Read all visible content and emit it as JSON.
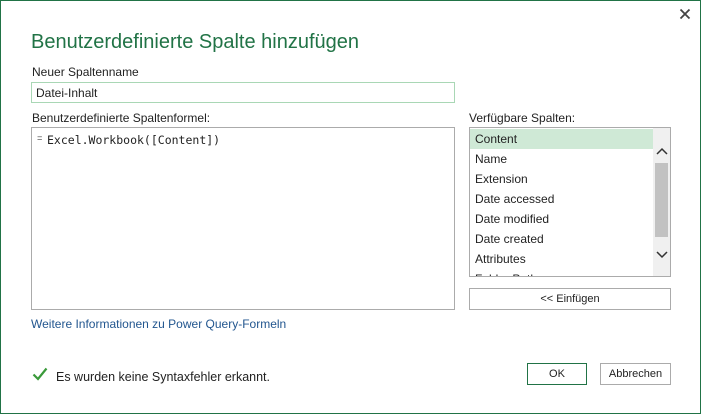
{
  "dialog": {
    "title": "Benutzerdefinierte Spalte hinzufügen",
    "accent_color": "#217346"
  },
  "name_field": {
    "label": "Neuer Spaltenname",
    "value": "Datei-Inhalt"
  },
  "formula": {
    "label": "Benutzerdefinierte Spaltenformel:",
    "prefix": "=",
    "code": "Excel.Workbook([Content])"
  },
  "columns": {
    "label": "Verfügbare Spalten:",
    "items": [
      "Content",
      "Name",
      "Extension",
      "Date accessed",
      "Date modified",
      "Date created",
      "Attributes",
      "Folder Path"
    ],
    "selected": "Content"
  },
  "buttons": {
    "insert": "<< Einfügen",
    "ok": "OK",
    "cancel": "Abbrechen"
  },
  "link": {
    "text": "Weitere Informationen zu Power Query-Formeln"
  },
  "status": {
    "text": "Es wurden keine Syntaxfehler erkannt.",
    "icon": "check-icon",
    "color": "#3a9a3a"
  }
}
